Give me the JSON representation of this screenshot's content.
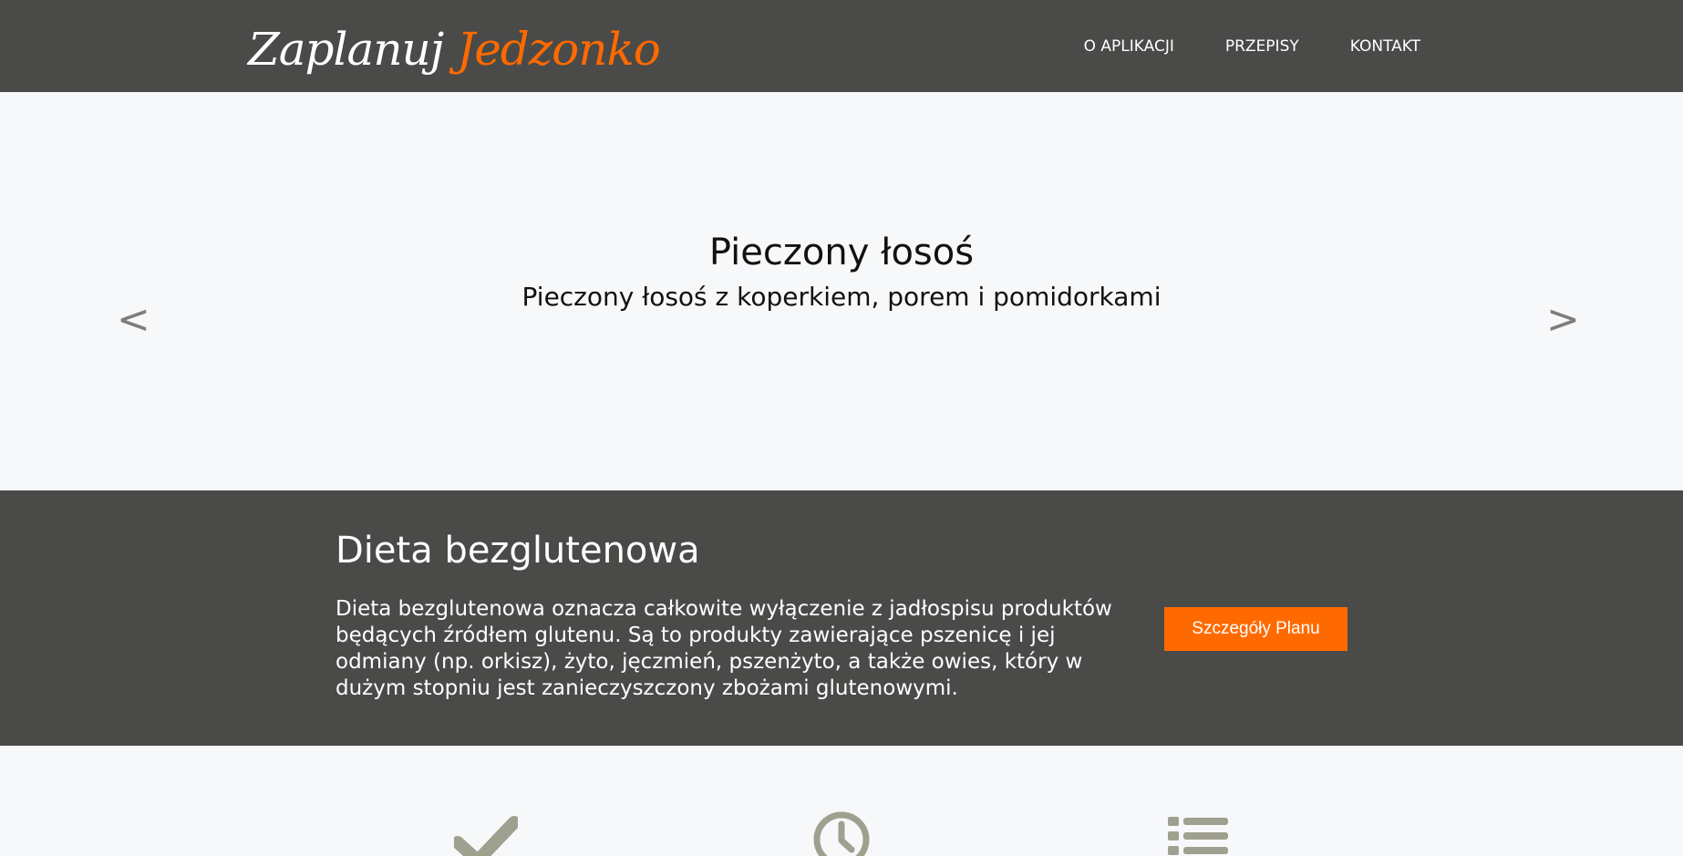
{
  "header": {
    "logo_part1": "Zaplanuj",
    "logo_part2": "Jedzonko",
    "nav": [
      {
        "label": "O APLIKACJI"
      },
      {
        "label": "PRZEPISY"
      },
      {
        "label": "KONTAKT"
      }
    ]
  },
  "hero": {
    "title": "Pieczony łosoś",
    "subtitle": "Pieczony łosoś z koperkiem, porem i pomidorkami",
    "prev_label": "<",
    "next_label": ">"
  },
  "diet": {
    "title": "Dieta bezglutenowa",
    "description": "Dieta bezglutenowa oznacza całkowite wyłączenie z jadłospisu produktów będących źródłem glutenu. Są to produkty zawierające pszenicę i jej odmiany (np. orkisz), żyto, jęczmień, pszenżyto, a także owies, który w dużym stopniu jest zanieczyszczony zbożami glutenowymi.",
    "button_label": "Szczegóły Planu"
  },
  "features": {
    "icons": [
      "checkmark-icon",
      "clock-icon",
      "list-icon"
    ]
  },
  "colors": {
    "header_bg": "#4a4a48",
    "accent": "#ff6a00",
    "page_bg": "#f7f8fa",
    "icon_gray": "#a0a090"
  }
}
